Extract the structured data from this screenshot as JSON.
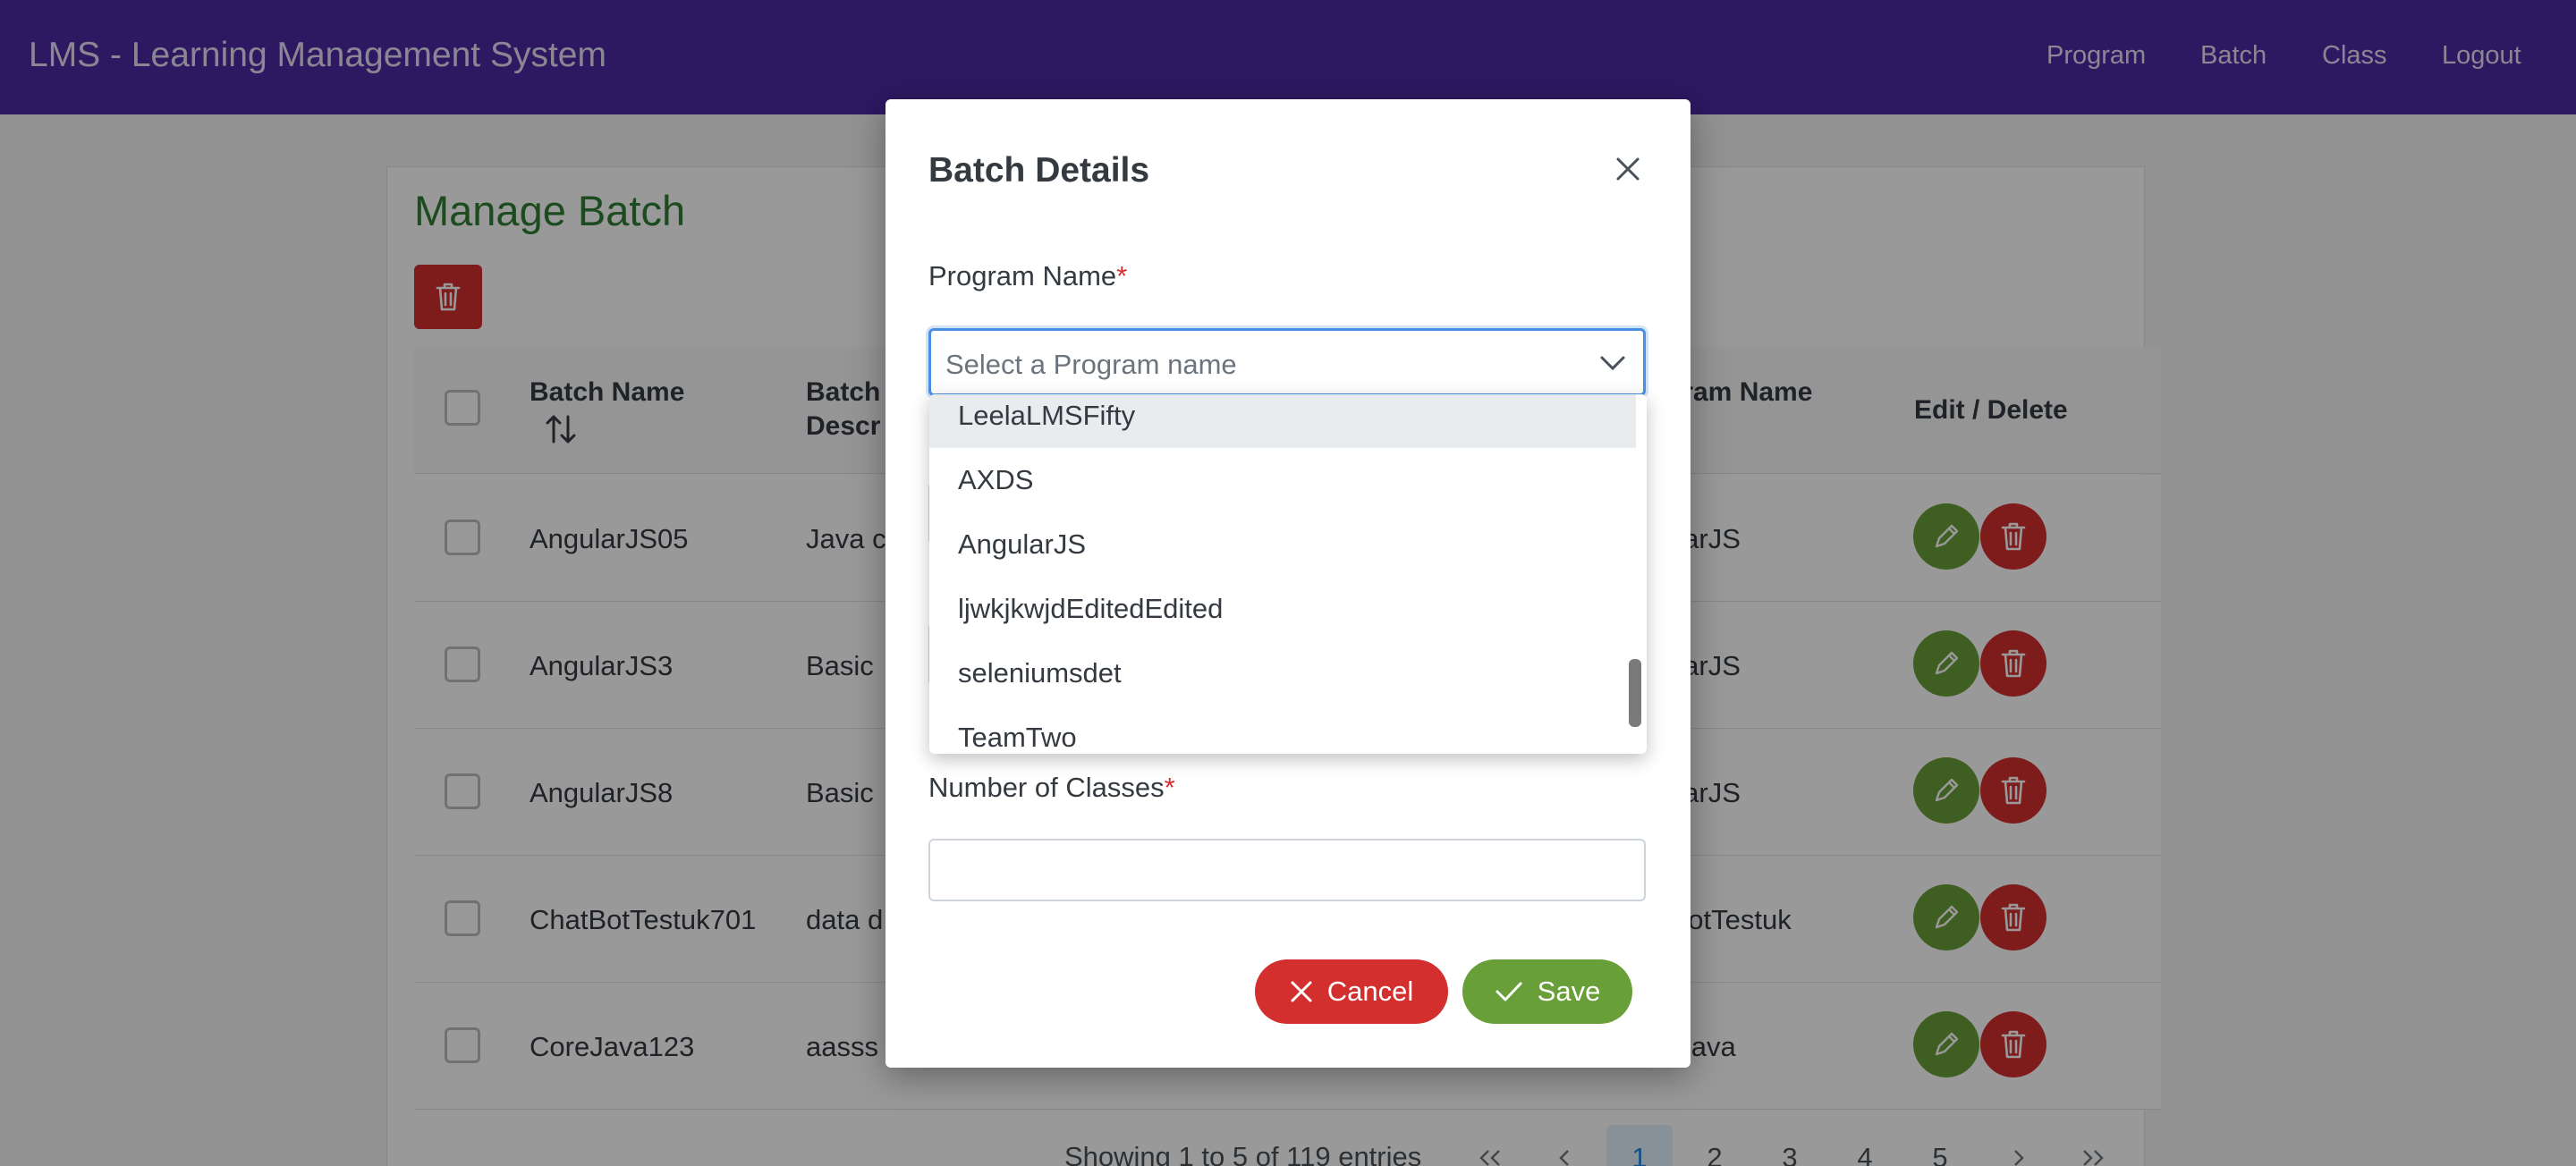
{
  "header": {
    "app_title": "LMS - Learning Management System",
    "nav": [
      "Program",
      "Batch",
      "Class",
      "Logout"
    ]
  },
  "page": {
    "title": "Manage Batch",
    "columns": {
      "batch_name": "Batch Name",
      "batch_desc": "Batch Descr",
      "program_name": "gram Name",
      "edit_delete": "Edit / Delete"
    },
    "rows": [
      {
        "name": "AngularJS05",
        "desc": "Java c",
        "program": "ularJS"
      },
      {
        "name": "AngularJS3",
        "desc": "Basic",
        "program": "ularJS"
      },
      {
        "name": "AngularJS8",
        "desc": "Basic",
        "program": "ularJS"
      },
      {
        "name": "ChatBotTestuk701",
        "desc": "data d",
        "program": "tBotTestuk"
      },
      {
        "name": "CoreJava123",
        "desc": "aasss",
        "program": "eJava"
      }
    ],
    "pagination": {
      "summary": "Showing 1 to 5 of 119 entries",
      "pages": [
        "1",
        "2",
        "3",
        "4",
        "5"
      ],
      "current": "1"
    }
  },
  "dialog": {
    "title": "Batch Details",
    "program_label": "Program Name",
    "program_placeholder": "Select a Program name",
    "num_classes_label": "Number of Classes",
    "required_mark": "*",
    "cancel_label": "Cancel",
    "save_label": "Save",
    "options": [
      "LeelaLMSFifty",
      "AXDS",
      "AngularJS",
      "ljwkjkwjdEditedEdited",
      "seleniumsdet",
      "TeamTwo"
    ],
    "highlighted_option": "LeelaLMSFifty"
  },
  "colors": {
    "topbar": "#4a2aa4",
    "title_green": "#2e7d32",
    "edit_green": "#689f38",
    "delete_red": "#d32f2f",
    "focus_blue": "#4a90e2"
  }
}
